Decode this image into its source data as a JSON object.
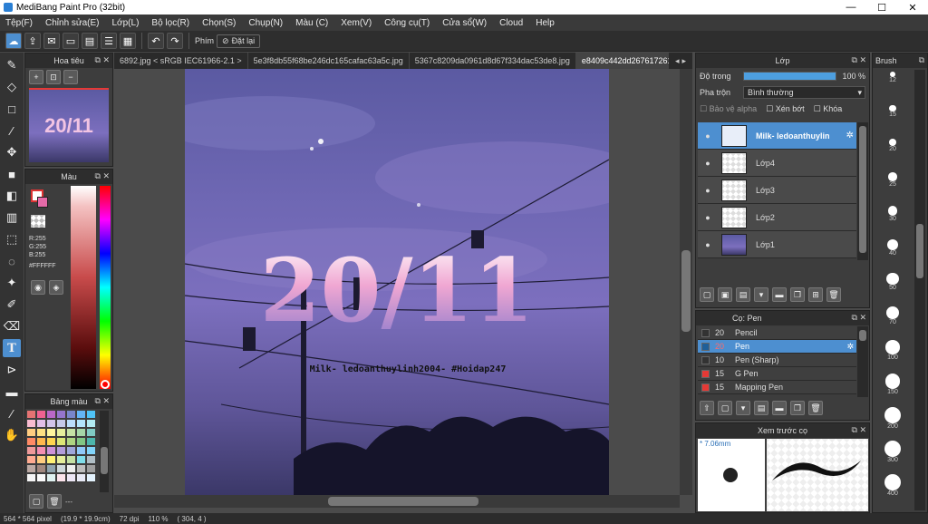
{
  "window": {
    "title": "MediBang Paint Pro (32bit)",
    "min": "—",
    "max": "☐",
    "close": "✕"
  },
  "menu": [
    "Tệp(F)",
    "Chỉnh sửa(E)",
    "Lớp(L)",
    "Bộ lọc(R)",
    "Chọn(S)",
    "Chụp(N)",
    "Màu (C)",
    "Xem(V)",
    "Công cụ(T)",
    "Cửa sổ(W)",
    "Cloud",
    "Help"
  ],
  "toolbar": {
    "keys_label": "Phím",
    "reset_label": "Đặt lại"
  },
  "navigator": {
    "title": "Hoa tiêu"
  },
  "color_panel": {
    "title": "Màu",
    "r": "R:255",
    "g": "G:255",
    "b": "B:255",
    "hex": "#FFFFFF"
  },
  "palette": {
    "title": "Bảng màu",
    "footer": "---"
  },
  "doc_tabs": [
    "6892.jpg < sRGB IEC61966-2.1 >",
    "5e3f8db55f68be246dc165cafac63a5c.jpg",
    "5367c8209da0961d8d67f334dac53de8.jpg",
    "e8409c442dd267617261f2d28b53f686.jpg"
  ],
  "artwork": {
    "big_text": "20/11",
    "caption": "Milk- ledoanthuylinh2004- #Hoidap247"
  },
  "layers": {
    "title": "Lớp",
    "opacity_label": "Độ trong",
    "opacity_value": "100 %",
    "opacity": 1.0,
    "blend_label": "Pha trộn",
    "blend_value": "Bình thường",
    "protect_alpha": "Bảo vệ alpha",
    "clip": "Xén bớt",
    "lock": "Khóa",
    "items": [
      {
        "name": "Milk- ledoanthuylin",
        "selected": true
      },
      {
        "name": "Lớp4",
        "selected": false
      },
      {
        "name": "Lớp3",
        "selected": false
      },
      {
        "name": "Lớp2",
        "selected": false
      },
      {
        "name": "Lớp1",
        "selected": false
      }
    ]
  },
  "brush_panel": {
    "title": "Cọ: Pen",
    "items": [
      {
        "size": "20",
        "name": "Pencil",
        "color": "#333333"
      },
      {
        "size": "20",
        "name": "Pen",
        "color": "#1f5f99",
        "selected": true
      },
      {
        "size": "10",
        "name": "Pen (Sharp)",
        "color": "#333333"
      },
      {
        "size": "15",
        "name": "G Pen",
        "color": "#e53935"
      },
      {
        "size": "15",
        "name": "Mapping Pen",
        "color": "#e53935"
      }
    ]
  },
  "preview": {
    "title": "Xem trước cọ",
    "size": "* 7.06mm"
  },
  "brush_sizes": {
    "title": "Brush",
    "sizes": [
      "12",
      "15",
      "20",
      "25",
      "30",
      "40",
      "50",
      "70",
      "100",
      "150",
      "200",
      "300",
      "400"
    ]
  },
  "status": {
    "size": "564 * 564 pixel",
    "mm": "(19.9 * 19.9cm)",
    "dpi": "72 dpi",
    "zoom": "110 %",
    "coords": "( 304, 4 )"
  }
}
